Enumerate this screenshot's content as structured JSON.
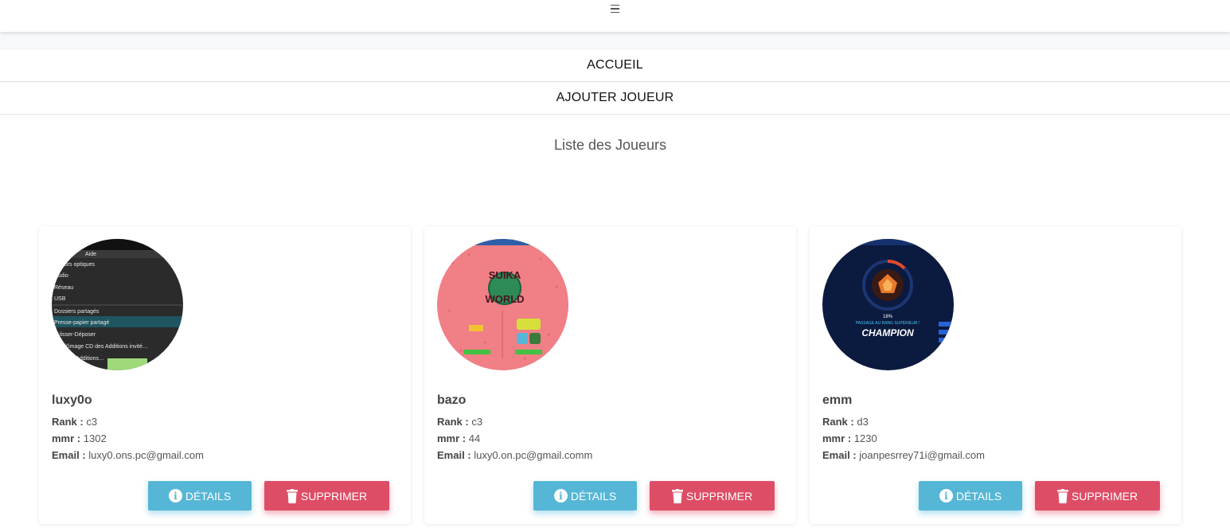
{
  "topbar": {
    "menu_icon": "hamburger-icon"
  },
  "nav": {
    "items": [
      {
        "label": "ACCUEIL"
      },
      {
        "label": "AJOUTER JOUEUR"
      }
    ]
  },
  "page": {
    "title": "Liste des Joueurs"
  },
  "labels": {
    "rank": "Rank :",
    "mmr": "mmr :",
    "email": "Email :"
  },
  "actions": {
    "details": "DÉTAILS",
    "delete": "SUPPRIMER"
  },
  "players": [
    {
      "name": "luxy0o",
      "rank": "c3",
      "mmr": "1302",
      "email": "luxy0.ons.pc@gmail.com",
      "avatar": {
        "menu_items": [
          "Aide",
          "…teurs optiques",
          "Audio",
          "Réseau",
          "USB",
          "Dossiers partagés",
          "Presse-papier partagé",
          "…lisser-Déposer",
          "…er l'image CD des Additions invité…",
          "…Guest Additions…"
        ]
      }
    },
    {
      "name": "bazo",
      "rank": "c3",
      "mmr": "44",
      "email": "luxy0.on.pc@gmail.comm",
      "avatar": {
        "game_logo_top": "SUIKA",
        "game_logo_bottom": "WORLD"
      }
    },
    {
      "name": "emm",
      "rank": "d3",
      "mmr": "1230",
      "email": "joanpesrrey71i@gmail.com",
      "avatar": {
        "progress": "18%",
        "subtitle": "PASSAGE AU RANG SUPÉRIEUR !",
        "rank_title": "CHAMPION"
      }
    }
  ],
  "colors": {
    "details": "#55b6d6",
    "delete": "#de4d66"
  }
}
